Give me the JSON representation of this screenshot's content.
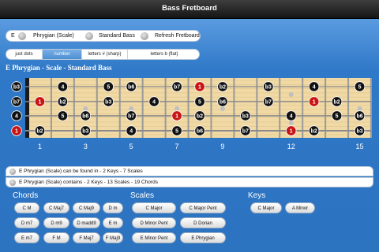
{
  "title": "Bass Fretboard",
  "controls": [
    {
      "label": "E"
    },
    {
      "label": "Phrygian (Scale)"
    },
    {
      "label": "Standard Bass"
    },
    {
      "label": "Refresh Fretboard"
    }
  ],
  "tabs": [
    {
      "label": "just dots",
      "active": false
    },
    {
      "label": "number",
      "active": true
    },
    {
      "label": "letters # (sharp)",
      "active": false
    },
    {
      "label": "letters b (flat)",
      "active": false
    }
  ],
  "heading": "E Phrygian - Scale - Standard Bass",
  "fret_numbers": [
    "1",
    "3",
    "5",
    "7",
    "9",
    "12",
    "15"
  ],
  "strings": [
    {
      "open": "b3",
      "notes": [
        {
          "f": 2,
          "t": "4"
        },
        {
          "f": 4,
          "t": "5"
        },
        {
          "f": 5,
          "t": "b6"
        },
        {
          "f": 7,
          "t": "b7"
        },
        {
          "f": 8,
          "t": "1",
          "root": true
        },
        {
          "f": 9,
          "t": "b2"
        },
        {
          "f": 11,
          "t": "b3"
        },
        {
          "f": 13,
          "t": "4"
        },
        {
          "f": 15,
          "t": "5"
        }
      ]
    },
    {
      "open": "b7",
      "notes": [
        {
          "f": 1,
          "t": "1",
          "root": true
        },
        {
          "f": 2,
          "t": "b2"
        },
        {
          "f": 4,
          "t": "b3"
        },
        {
          "f": 6,
          "t": "4"
        },
        {
          "f": 8,
          "t": "5"
        },
        {
          "f": 9,
          "t": "b6"
        },
        {
          "f": 11,
          "t": "b7"
        },
        {
          "f": 13,
          "t": "1",
          "root": true
        },
        {
          "f": 14,
          "t": "b2"
        }
      ]
    },
    {
      "open": "4",
      "notes": [
        {
          "f": 2,
          "t": "5"
        },
        {
          "f": 3,
          "t": "b6"
        },
        {
          "f": 5,
          "t": "b7"
        },
        {
          "f": 7,
          "t": "1",
          "root": true
        },
        {
          "f": 8,
          "t": "b2"
        },
        {
          "f": 10,
          "t": "b3"
        },
        {
          "f": 12,
          "t": "4"
        },
        {
          "f": 14,
          "t": "5"
        },
        {
          "f": 15,
          "t": "b6"
        }
      ]
    },
    {
      "open": "1",
      "root_open": true,
      "notes": [
        {
          "f": 1,
          "t": "b2"
        },
        {
          "f": 3,
          "t": "b3"
        },
        {
          "f": 5,
          "t": "4"
        },
        {
          "f": 7,
          "t": "5"
        },
        {
          "f": 8,
          "t": "b6"
        },
        {
          "f": 10,
          "t": "b7"
        },
        {
          "f": 12,
          "t": "1",
          "root": true
        },
        {
          "f": 13,
          "t": "b2"
        },
        {
          "f": 15,
          "t": "b3"
        }
      ]
    }
  ],
  "info_found": "E Phrygian (Scale) can be found in - 2 Keys - 7 Scales",
  "info_contains": "E Phrygian (Scale) contains - 2 Keys - 13 Scales - 19 Chords",
  "sections": {
    "chords": "Chords",
    "scales": "Scales",
    "keys": "Keys"
  },
  "chords": [
    [
      "C M",
      "C Maj7",
      "C Maj9",
      "D m"
    ],
    [
      "D m7",
      "D m9",
      "D madd9",
      "E m"
    ],
    [
      "E m7",
      "F M",
      "F Maj7",
      "F Maj9"
    ]
  ],
  "scales": [
    "C Major",
    "C Major Pent",
    "D Minor Pent",
    "D Dorian",
    "E Minor Pent",
    "E Phrygian"
  ],
  "keys": [
    "C Major",
    "A Minor"
  ],
  "colors": {
    "accent": "#2f79c8",
    "root_note": "#c81414",
    "note": "#111111",
    "fretboard": "#f0d9a4"
  }
}
